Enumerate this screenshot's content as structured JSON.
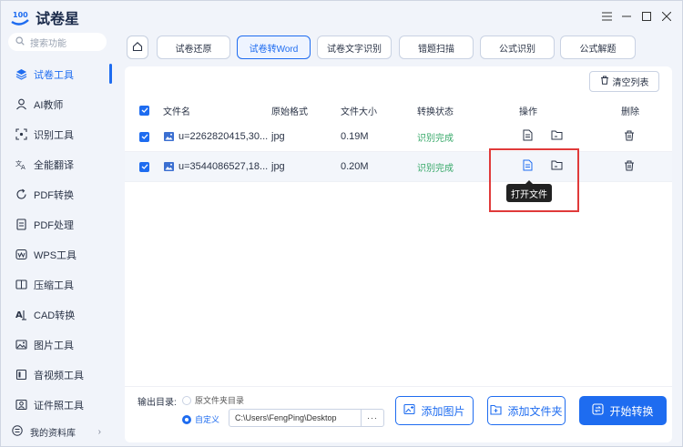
{
  "app": {
    "name": "试卷星"
  },
  "sidebar": {
    "search_placeholder": "搜索功能",
    "items": [
      {
        "label": "试卷工具",
        "icon": "layers-icon",
        "active": true
      },
      {
        "label": "AI教师",
        "icon": "teacher-icon"
      },
      {
        "label": "识别工具",
        "icon": "scan-icon"
      },
      {
        "label": "全能翻译",
        "icon": "translate-icon"
      },
      {
        "label": "PDF转换",
        "icon": "pdf-convert-icon"
      },
      {
        "label": "PDF处理",
        "icon": "pdf-process-icon"
      },
      {
        "label": "WPS工具",
        "icon": "wps-icon"
      },
      {
        "label": "压缩工具",
        "icon": "compress-icon"
      },
      {
        "label": "CAD转换",
        "icon": "cad-icon"
      },
      {
        "label": "图片工具",
        "icon": "image-icon"
      },
      {
        "label": "音视频工具",
        "icon": "media-icon"
      },
      {
        "label": "证件照工具",
        "icon": "id-photo-icon"
      }
    ],
    "library": "我的资料库"
  },
  "tabs": [
    {
      "label": "试卷还原"
    },
    {
      "label": "试卷转Word",
      "active": true
    },
    {
      "label": "试卷文字识别"
    },
    {
      "label": "错题扫描"
    },
    {
      "label": "公式识别"
    },
    {
      "label": "公式解题"
    }
  ],
  "toolbar": {
    "clear_label": "清空列表"
  },
  "table": {
    "headers": {
      "name": "文件名",
      "format": "原始格式",
      "size": "文件大小",
      "status": "转换状态",
      "actions": "操作",
      "delete": "删除"
    },
    "rows": [
      {
        "name": "u=2262820415,30...",
        "format": "jpg",
        "size": "0.19M",
        "status": "识别完成"
      },
      {
        "name": "u=3544086527,18...",
        "format": "jpg",
        "size": "0.20M",
        "status": "识别完成"
      }
    ]
  },
  "tooltip": "打开文件",
  "output": {
    "label": "输出目录:",
    "option_source": "原文件夹目录",
    "option_custom": "自定义",
    "path": "C:\\Users\\FengPing\\Desktop",
    "browse": "···"
  },
  "buttons": {
    "add_image": "添加图片",
    "add_folder": "添加文件夹",
    "start": "开始转换"
  },
  "colors": {
    "accent": "#1e6cf0",
    "success": "#38a96a",
    "highlight": "#e03a3a"
  }
}
